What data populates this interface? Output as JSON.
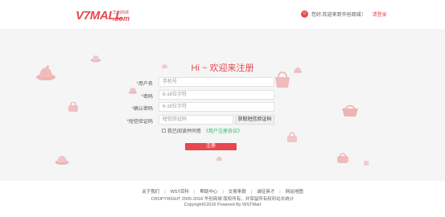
{
  "header": {
    "logo_main": "V7MALL",
    "logo_sub": "华创商城",
    "logo_com": ".com",
    "greeting": "您好,欢迎来到华创商城！",
    "login_link": "请登录"
  },
  "form": {
    "title": "Hi ~ 欢迎来注册",
    "username": {
      "label": "用户名",
      "placeholder": "手机号"
    },
    "password": {
      "label": "密码",
      "placeholder": "6-16位字符"
    },
    "confirm": {
      "label": "确认密码",
      "placeholder": "6-16位字符"
    },
    "sms": {
      "label": "短信验证码",
      "placeholder": "短信验证码",
      "button": "获取短信验证码"
    },
    "agree_text": "我已阅读并同意",
    "agree_link": "《用户注册协议》",
    "submit": "注册"
  },
  "footer": {
    "links": [
      "关于我们",
      "WST百科",
      "帮助中心",
      "交易条款",
      "诚征英才",
      "网站地图"
    ],
    "copyright": "CROPYRIGHT 2005-2018 华创商城 版权所有，并保留所有权利站长统计",
    "powered": "Copyright©2016 Powered By WSTMart"
  },
  "colors": {
    "accent": "#e5484d",
    "link_green": "#2bb673",
    "panel_bg": "#f5f5f5"
  }
}
